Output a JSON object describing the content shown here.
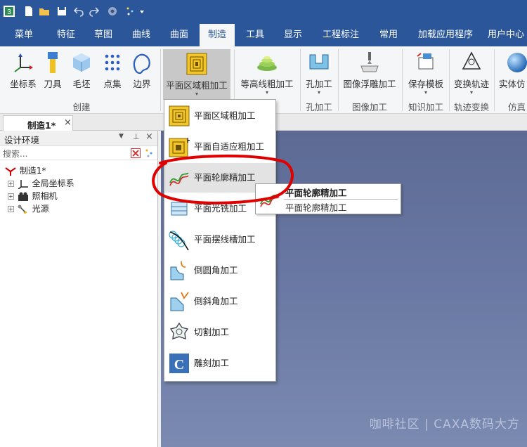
{
  "menu_tabs": [
    "菜单",
    "特征",
    "草图",
    "曲线",
    "曲面",
    "制造",
    "工具",
    "显示",
    "工程标注",
    "常用",
    "加载应用程序",
    "用户中心"
  ],
  "active_tab_index": 5,
  "ribbon": {
    "create_group": {
      "label": "创建",
      "buttons": [
        "坐标系",
        "刀具",
        "毛坯",
        "点集",
        "边界"
      ]
    },
    "planar_rough": "平面区域粗加工",
    "contour_rough": "等高线粗加工",
    "hole": {
      "button": "孔加工",
      "group": "孔加工"
    },
    "image": {
      "button": "图像浮雕加工",
      "group": "图像加工"
    },
    "knowledge": {
      "button": "保存模板",
      "group": "知识加工"
    },
    "trajectory": {
      "button": "变换轨迹",
      "group": "轨迹变换"
    },
    "solid": {
      "button": "实体仿",
      "group": "仿真"
    }
  },
  "doc_tab": {
    "label": "制造1*",
    "close": "×"
  },
  "panel": {
    "title": "设计环境",
    "search_placeholder": "搜索...",
    "root": "制造1*",
    "children": [
      "全局坐标系",
      "照相机",
      "光源"
    ]
  },
  "dropdown_items": [
    "平面区域粗加工",
    "平面自适应粗加工",
    "平面轮廓精加工",
    "平面光铣加工",
    "平面摆线槽加工",
    "倒圆角加工",
    "倒斜角加工",
    "切割加工",
    "雕刻加工"
  ],
  "hovered_item_index": 2,
  "tooltip": {
    "title": "平面轮廓精加工",
    "desc": "平面轮廓精加工"
  },
  "watermark": "咖啡社区 | CAXA数码大方",
  "colors": {
    "title_bar": "#2b579a",
    "viewport_top": "#5c6a94",
    "annotation": "#e00000"
  },
  "icons": [
    "app-logo-icon",
    "new-file-icon",
    "open-folder-icon",
    "save-icon",
    "undo-icon",
    "redo-icon",
    "gear-icon",
    "magic-icon",
    "dropdown-arrow-icon"
  ]
}
